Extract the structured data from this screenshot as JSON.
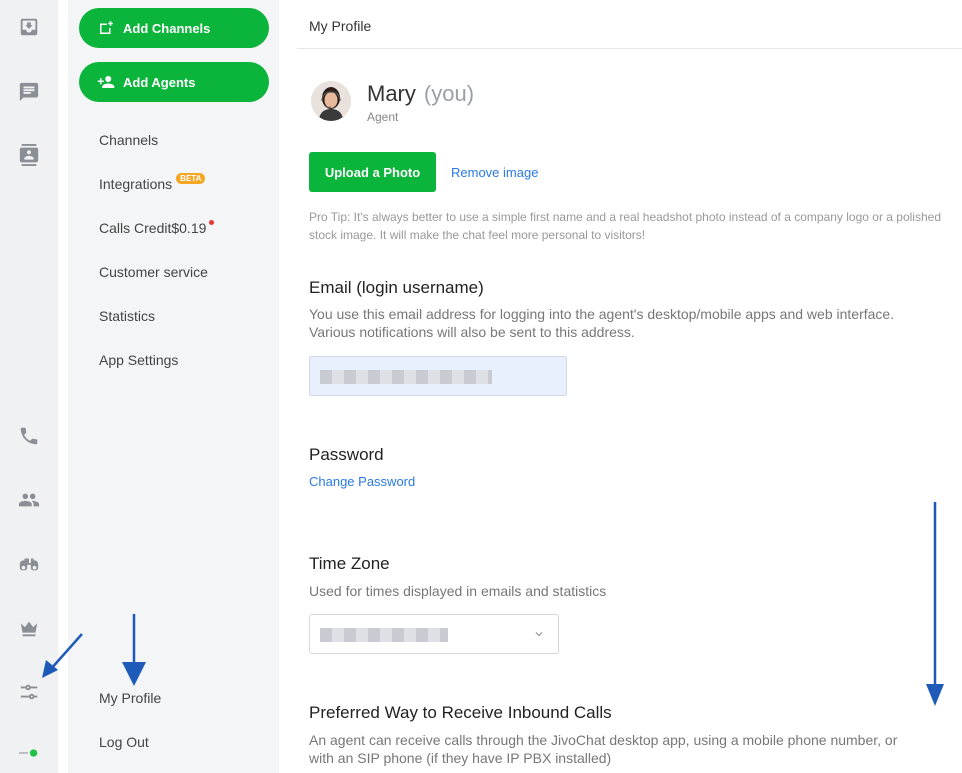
{
  "rail": {
    "top_icons": [
      "inbox-icon",
      "chat-icon",
      "contacts-icon"
    ],
    "bottom_icons": [
      "phone-icon",
      "team-icon",
      "binoculars-icon",
      "crown-icon",
      "settings-sliders-icon",
      "status-toggle-icon"
    ],
    "status_color": "#21c147"
  },
  "nav": {
    "add_channels": "Add Channels",
    "add_agents": "Add Agents",
    "items": [
      {
        "label": "Channels"
      },
      {
        "label": "Integrations",
        "badge": "BETA"
      },
      {
        "label": "Calls Credit",
        "value": "$0.19"
      },
      {
        "label": "Customer service"
      },
      {
        "label": "Statistics"
      },
      {
        "label": "App Settings"
      }
    ],
    "bottom_items": [
      {
        "label": "My Profile"
      },
      {
        "label": "Log Out"
      }
    ]
  },
  "header": {
    "title": "My Profile"
  },
  "profile": {
    "name": "Mary",
    "you": "(you)",
    "role": "Agent",
    "upload_label": "Upload a Photo",
    "remove_label": "Remove image",
    "tip": "Pro Tip: It's always better to use a simple first name and a real headshot photo instead of a company logo or a polished stock image. It will make the chat feel more personal to visitors!"
  },
  "email": {
    "heading": "Email (login username)",
    "desc": "You use this email address for logging into the agent's desktop/mobile apps and web interface. Various notifications will also be sent to this address."
  },
  "password": {
    "heading": "Password",
    "change_label": "Change Password"
  },
  "timezone": {
    "heading": "Time Zone",
    "desc": "Used for times displayed in emails and statistics"
  },
  "inbound": {
    "heading": "Preferred Way to Receive Inbound Calls",
    "desc": "An agent can receive calls through the JivoChat desktop app, using a mobile phone number, or with an SIP phone (if they have IP PBX installed)"
  },
  "colors": {
    "accent_green": "#0bb43a",
    "link_blue": "#2a7ae2",
    "annotation_arrow": "#1e5bb8",
    "beta_orange": "#f5a623"
  }
}
